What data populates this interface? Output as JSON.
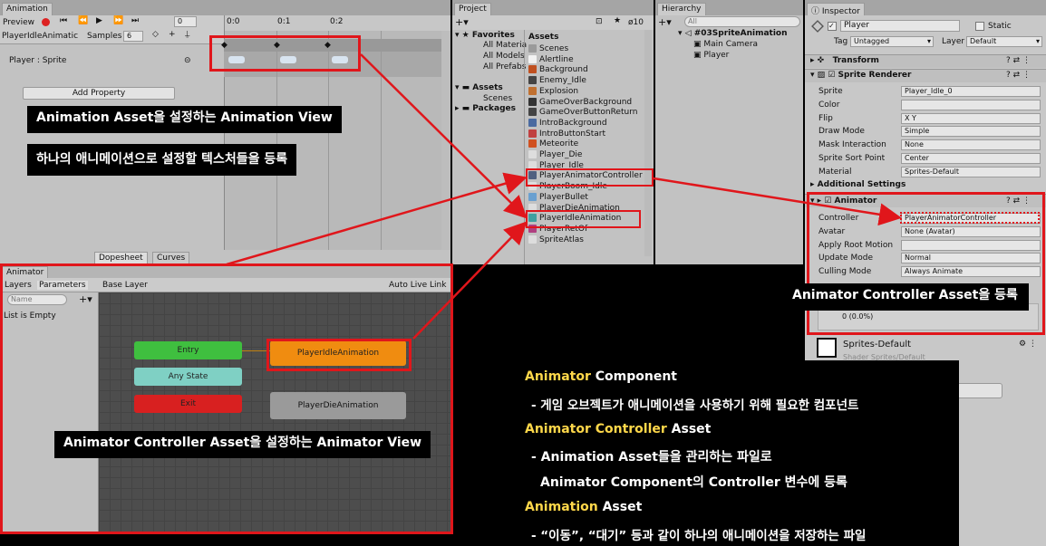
{
  "animation": {
    "tab": "Animation",
    "preview": "Preview",
    "frame": "0",
    "clip": "PlayerIdleAnimatic",
    "samples_label": "Samples",
    "samples": "6",
    "ticks": [
      "0:0",
      "0:1",
      "0:2"
    ],
    "property": "Player : Sprite",
    "add_property": "Add Property",
    "dopesheet": "Dopesheet",
    "curves": "Curves"
  },
  "animator": {
    "tab": "Animator",
    "layers": "Layers",
    "parameters": "Parameters",
    "base_layer": "Base Layer",
    "auto_live": "Auto Live Link",
    "search_placeholder": "Name",
    "empty": "List is Empty",
    "states": {
      "entry": "Entry",
      "any": "Any State",
      "exit": "Exit",
      "idle": "PlayerIdleAnimation",
      "die": "PlayerDieAnimation"
    }
  },
  "project": {
    "tab": "Project",
    "count": "10",
    "favorites": "Favorites",
    "fav_items": [
      "All Materia",
      "All Models",
      "All Prefabs"
    ],
    "assets": "Assets",
    "tree": [
      "Scenes"
    ],
    "packages": "Packages",
    "assets_title": "Assets",
    "files": [
      "Scenes",
      "Alertline",
      "Background",
      "Enemy_Idle",
      "Explosion",
      "GameOverBackground",
      "GameOverButtonReturn",
      "IntroBackground",
      "IntroButtonStart",
      "Meteorite",
      "Player_Die",
      "Player_Idle",
      "PlayerAnimatorController",
      "PlayerBoom_Idle",
      "PlayerBullet",
      "PlayerDieAnimation",
      "PlayerIdleAnimation",
      "PlayerRetOf",
      "SpriteAtlas"
    ]
  },
  "hierarchy": {
    "tab": "Hierarchy",
    "search": "All",
    "scene": "#03SpriteAnimation",
    "items": [
      "Main Camera",
      "Player"
    ]
  },
  "inspector": {
    "tab": "Inspector",
    "name": "Player",
    "static": "Static",
    "tag_label": "Tag",
    "tag": "Untagged",
    "layer_label": "Layer",
    "layer": "Default",
    "transform": "Transform",
    "sprite_renderer": "Sprite Renderer",
    "sr_rows": [
      {
        "label": "Sprite",
        "value": "Player_Idle_0"
      },
      {
        "label": "Color",
        "value": ""
      },
      {
        "label": "Flip",
        "value": "X  Y"
      },
      {
        "label": "Draw Mode",
        "value": "Simple"
      },
      {
        "label": "Mask Interaction",
        "value": "None"
      },
      {
        "label": "Sprite Sort Point",
        "value": "Center"
      },
      {
        "label": "Material",
        "value": "Sprites-Default"
      }
    ],
    "additional": "Additional Settings",
    "animator": "Animator",
    "an_rows": [
      {
        "label": "Controller",
        "value": "PlayerAnimatorController"
      },
      {
        "label": "Avatar",
        "value": "None (Avatar)"
      },
      {
        "label": "Apply Root Motion",
        "value": ""
      },
      {
        "label": "Update Mode",
        "value": "Normal"
      },
      {
        "label": "Culling Mode",
        "value": "Always Animate"
      }
    ],
    "info": "0 (0.0%)",
    "material": "Sprites-Default",
    "shader": "Shader   Sprites/Default"
  },
  "notes": {
    "n1": "Animation Asset을 설정하는 Animation View",
    "n2": "하나의 애니메이션으로 설정할 텍스처들을 등록",
    "n3": "Animator Controller Asset을 등록",
    "n4": "Animator Controller Asset을 설정하는 Animator View"
  },
  "legend": {
    "l1a": "Animator",
    "l1b": " Component",
    "l2": "- 게임 오브젝트가 애니메이션을 사용하기 위해 필요한 컴포넌트",
    "l3a": "Animator Controller",
    "l3b": " Asset",
    "l4": "- Animation Asset들을 관리하는 파일로",
    "l5": "Animator Component의 Controller 변수에 등록",
    "l6a": "Animation",
    "l6b": " Asset",
    "l7": "- “이동”, “대기” 등과 같이 하나의 애니메이션을 저장하는 파일"
  },
  "colors": {
    "highlight": "#e0161b",
    "yellow": "#ffd84a"
  }
}
